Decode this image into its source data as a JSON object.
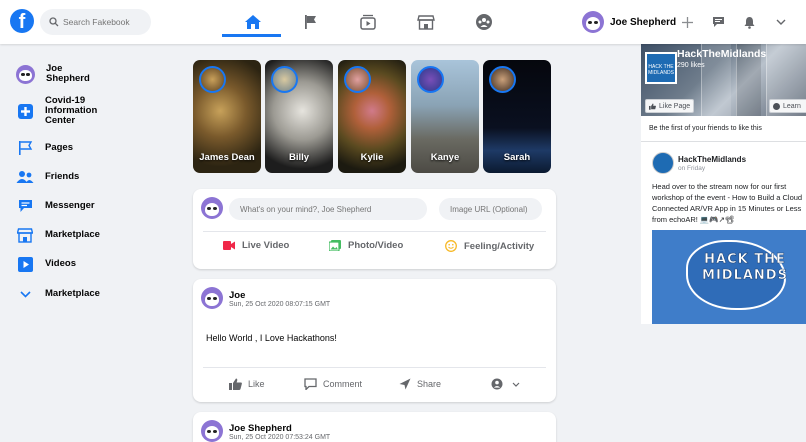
{
  "colors": {
    "brand": "#1877f2",
    "page_bg": "#f0f2f5",
    "card_bg": "#ffffff",
    "muted_text": "#65676b",
    "live_red": "#f02849",
    "photo_green": "#45bd62",
    "feeling_yellow": "#f7b928"
  },
  "header": {
    "logo": "f",
    "search_placeholder": "Search Fakebook",
    "nav": [
      {
        "name": "home-icon",
        "active": true
      },
      {
        "name": "flag-icon",
        "active": false
      },
      {
        "name": "watch-icon",
        "active": false
      },
      {
        "name": "marketplace-icon",
        "active": false
      },
      {
        "name": "groups-icon",
        "active": false
      }
    ],
    "profile_name": "Joe Shepherd",
    "actions": [
      "plus-icon",
      "messenger-icon",
      "notifications-icon",
      "chevron-down-icon"
    ]
  },
  "sidebar": {
    "items": [
      {
        "label": "Joe\nShepherd",
        "icon": "avatar"
      },
      {
        "label": "Covid-19\nInformation\nCenter",
        "icon": "covid-info-icon"
      },
      {
        "label": "Pages",
        "icon": "pages-flag-icon"
      },
      {
        "label": "Friends",
        "icon": "friends-icon"
      },
      {
        "label": "Messenger",
        "icon": "messenger-icon"
      },
      {
        "label": "Marketplace",
        "icon": "marketplace-icon"
      },
      {
        "label": "Videos",
        "icon": "videos-icon"
      },
      {
        "label": "Marketplace",
        "icon": "chevron-down-icon"
      }
    ]
  },
  "stories": [
    {
      "name": "James Dean"
    },
    {
      "name": "Billy"
    },
    {
      "name": "Kylie"
    },
    {
      "name": "Kanye"
    },
    {
      "name": "Sarah"
    }
  ],
  "composer": {
    "placeholder": "What's on your mind?, Joe Shepherd",
    "image_placeholder": "Image URL (Optional)",
    "actions": [
      "Live Video",
      "Photo/Video",
      "Feeling/Activity"
    ]
  },
  "posts": [
    {
      "author": "Joe",
      "timestamp": "Sun, 25 Oct 2020 08:07:15 GMT",
      "text": "Hello World , I Love Hackathons!",
      "actions": [
        "Like",
        "Comment",
        "Share"
      ]
    },
    {
      "author": "Joe Shepherd",
      "timestamp": "Sun, 25 Oct 2020 07:53:24 GMT"
    }
  ],
  "right_panel": {
    "page_name": "HackTheMidlands",
    "likes": "290 likes",
    "like_button": "Like Page",
    "learn_button": "Learn",
    "friends_note": "Be the first of your friends to like this",
    "post": {
      "author": "HackTheMidlands",
      "when": "on Friday",
      "text": "Head over to the stream now for our first workshop of the event - How to Build a Cloud Connected AR/VR App in 15 Minutes or Less from echoAR! 💻🎮↗📽",
      "image_text": "HACK THE MIDLANDS"
    }
  }
}
